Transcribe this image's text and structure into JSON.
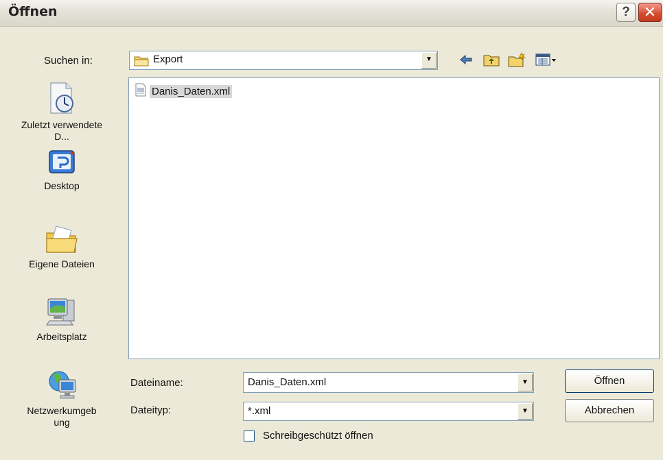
{
  "window": {
    "title": "Öffnen",
    "help_glyph": "?",
    "close_glyph": "✕"
  },
  "look_in": {
    "label": "Suchen in:",
    "value": "Export"
  },
  "places": [
    {
      "label": "Zuletzt verwendete D...",
      "icon": "recent-documents-icon"
    },
    {
      "label": "Desktop",
      "icon": "desktop-icon"
    },
    {
      "label": "Eigene Dateien",
      "icon": "my-documents-icon"
    },
    {
      "label": "Arbeitsplatz",
      "icon": "my-computer-icon"
    },
    {
      "label": "Netzwerkumgeb ung",
      "icon": "network-icon"
    }
  ],
  "files": [
    {
      "name": "Danis_Daten.xml",
      "icon": "xml-file-icon"
    }
  ],
  "filename": {
    "label": "Dateiname:",
    "value": "Danis_Daten.xml"
  },
  "filetype": {
    "label": "Dateityp:",
    "value": "*.xml"
  },
  "readonly": {
    "label": "Schreibgeschützt öffnen",
    "checked": false
  },
  "buttons": {
    "open": "Öffnen",
    "cancel": "Abbrechen"
  },
  "colors": {
    "dialog_bg": "#ece9d8",
    "border": "#7f9db9",
    "button_border": "#003c74"
  }
}
